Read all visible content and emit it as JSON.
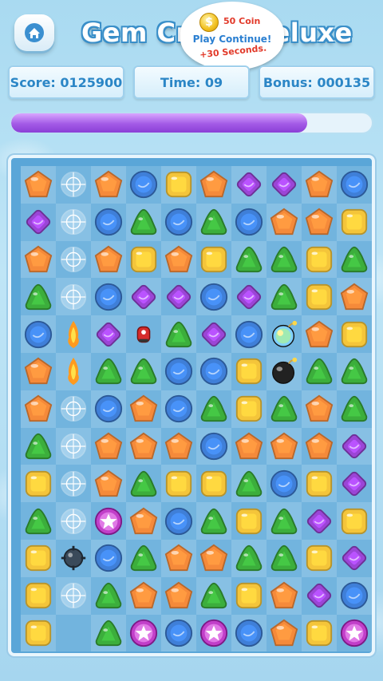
{
  "header": {
    "title": "Gem Crush Deluxe",
    "bubble": {
      "coin_label": "50 Coin",
      "line2": "Play Continue!",
      "line3": "+30 Seconds."
    }
  },
  "stats": {
    "score": "Score: 0125900",
    "time": "Time: 09",
    "bonus": "Bonus: 000135"
  },
  "progress": 0.82,
  "colors": {
    "orange": "#f58a3a",
    "blue": "#3f7fd8",
    "green": "#3cae3c",
    "yellow": "#f4c53a",
    "purple": "#9b45d6",
    "ice": "#dff3ff"
  },
  "board": {
    "rows": [
      [
        "orange",
        "ice",
        "orange",
        "blue",
        "yellow",
        "orange",
        "purple",
        "purple",
        "orange",
        "blue"
      ],
      [
        "purple",
        "ice",
        "blue",
        "green",
        "blue",
        "green",
        "blue",
        "orange",
        "orange",
        "yellow"
      ],
      [
        "orange",
        "ice",
        "orange",
        "yellow",
        "orange",
        "yellow",
        "green",
        "green",
        "yellow",
        "green"
      ],
      [
        "green",
        "ice",
        "blue",
        "purple",
        "purple",
        "blue",
        "purple",
        "green",
        "yellow",
        "orange"
      ],
      [
        "blue",
        "fire",
        "purple",
        "rocket",
        "green",
        "purple",
        "blue",
        "bomb-rainbow",
        "orange",
        "yellow"
      ],
      [
        "orange",
        "fire",
        "green",
        "green",
        "blue",
        "blue",
        "yellow",
        "bomb",
        "green",
        "green"
      ],
      [
        "orange",
        "ice",
        "blue",
        "orange",
        "blue",
        "green",
        "yellow",
        "green",
        "orange",
        "green"
      ],
      [
        "green",
        "ice",
        "orange",
        "orange",
        "orange",
        "blue",
        "orange",
        "orange",
        "orange",
        "purple"
      ],
      [
        "yellow",
        "ice",
        "orange",
        "green",
        "yellow",
        "yellow",
        "green",
        "blue",
        "yellow",
        "purple"
      ],
      [
        "green",
        "ice",
        "star-purple",
        "orange",
        "blue",
        "green",
        "yellow",
        "green",
        "purple",
        "yellow"
      ],
      [
        "yellow",
        "mine",
        "blue",
        "green",
        "orange",
        "orange",
        "green",
        "green",
        "yellow",
        "purple"
      ],
      [
        "yellow",
        "ice",
        "green",
        "orange",
        "orange",
        "green",
        "yellow",
        "orange",
        "purple",
        "blue"
      ],
      [
        "yellow",
        "empty",
        "green",
        "star-purple",
        "blue",
        "star-purple",
        "blue",
        "orange",
        "yellow",
        "star-purple"
      ]
    ]
  }
}
